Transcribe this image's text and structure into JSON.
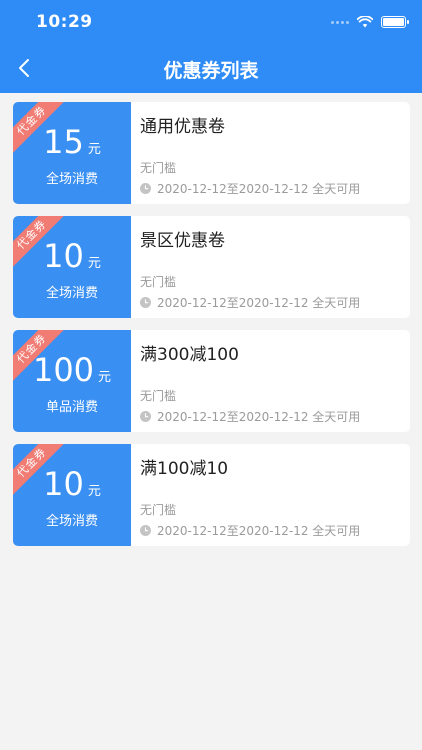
{
  "status": {
    "time": "10:29"
  },
  "nav": {
    "title": "优惠券列表"
  },
  "colors": {
    "primary": "#2f8cf7",
    "coupon_left": "#3a8ff2",
    "ribbon": "#f07c74",
    "page_bg": "#f3f3f3"
  },
  "coupons": [
    {
      "ribbon": "代金券",
      "amount": "15",
      "unit": "元",
      "scope": "全场消费",
      "title": "通用优惠卷",
      "threshold": "无门槛",
      "validity": "2020-12-12至2020-12-12 全天可用"
    },
    {
      "ribbon": "代金券",
      "amount": "10",
      "unit": "元",
      "scope": "全场消费",
      "title": "景区优惠卷",
      "threshold": "无门槛",
      "validity": "2020-12-12至2020-12-12 全天可用"
    },
    {
      "ribbon": "代金券",
      "amount": "100",
      "unit": "元",
      "scope": "单品消费",
      "title": "满300减100",
      "threshold": "无门槛",
      "validity": "2020-12-12至2020-12-12 全天可用"
    },
    {
      "ribbon": "代金券",
      "amount": "10",
      "unit": "元",
      "scope": "全场消费",
      "title": "满100减10",
      "threshold": "无门槛",
      "validity": "2020-12-12至2020-12-12 全天可用"
    }
  ]
}
